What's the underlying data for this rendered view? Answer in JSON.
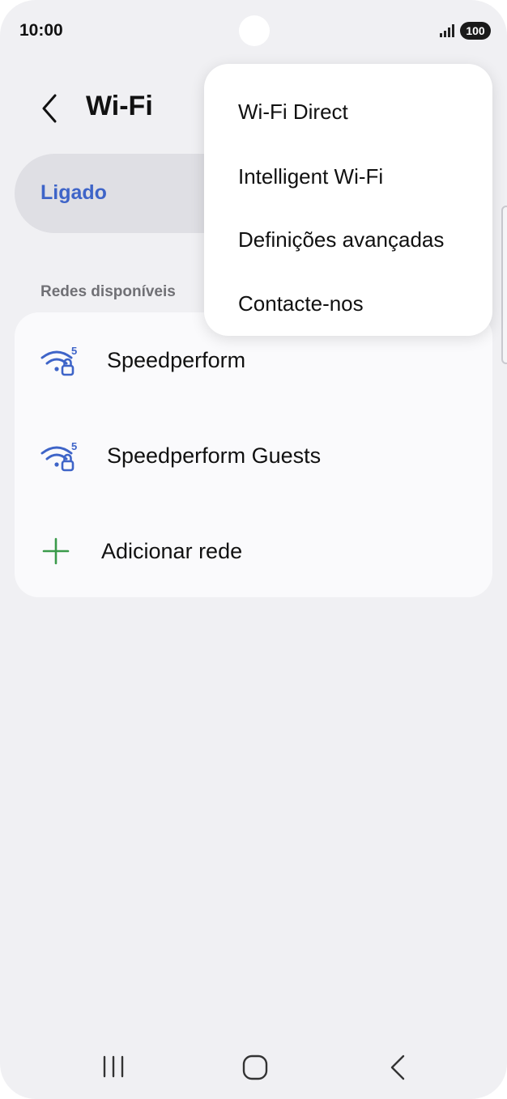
{
  "status_bar": {
    "time": "10:00",
    "battery": "100"
  },
  "header": {
    "title": "Wi-Fi"
  },
  "master_toggle": {
    "label": "Ligado"
  },
  "networks": {
    "section_title": "Redes disponíveis",
    "items": [
      {
        "name": "Speedperform",
        "band": "5",
        "secured": true,
        "icon": "wifi-5g-lock-icon"
      },
      {
        "name": "Speedperform Guests",
        "band": "5",
        "secured": true,
        "icon": "wifi-5g-lock-icon"
      }
    ],
    "add_label": "Adicionar rede"
  },
  "popup_menu": {
    "items": [
      {
        "label": "Wi-Fi Direct"
      },
      {
        "label": "Intelligent Wi-Fi"
      },
      {
        "label": "Definições avançadas"
      },
      {
        "label": "Contacte-nos"
      }
    ]
  },
  "colors": {
    "accent": "#3e64c8",
    "wifi_icon": "#3e64c8",
    "plus_icon": "#3a9a4a",
    "background": "#f0f0f3",
    "card": "#fafafc"
  }
}
